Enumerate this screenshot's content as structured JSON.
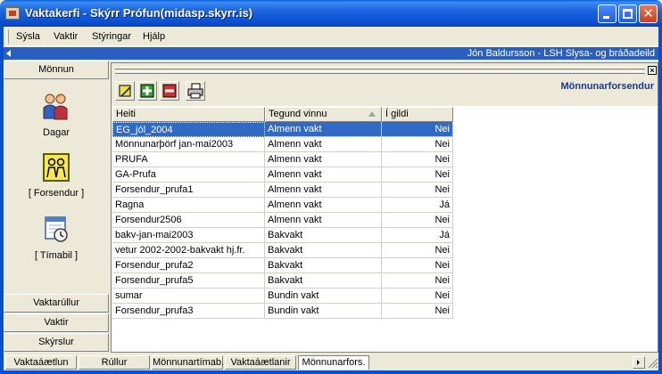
{
  "window": {
    "title": "Vaktakerfi - Skýrr Prófun(midasp.skyrr.is)"
  },
  "menu": {
    "items": [
      "Sýsla",
      "Vaktir",
      "Stýringar",
      "Hjálp"
    ]
  },
  "infobar": {
    "user": "Jón Baldursson - LSH Slysa- og bráðadeild"
  },
  "sidebar": {
    "header": "Mönnun",
    "icons": [
      {
        "label": "Dagar",
        "icon": "people-icon"
      },
      {
        "label": "[ Forsendur ]",
        "icon": "persons-frame-icon"
      },
      {
        "label": "[ Tímabil ]",
        "icon": "calendar-clock-icon"
      }
    ],
    "bottom": [
      "Vaktarúllur",
      "Vaktir",
      "Skýrslur"
    ]
  },
  "main": {
    "title": "Mönnunarforsendur",
    "toolbar": [
      "edit-icon",
      "add-icon",
      "remove-icon",
      "print-icon"
    ],
    "columns": [
      "Heiti",
      "Tegund vinnu",
      "Í gildi"
    ],
    "rows": [
      [
        "EG_jól_2004",
        "Almenn vakt",
        "Nei"
      ],
      [
        "Mönnunarþörf jan-mai2003",
        "Almenn vakt",
        "Nei"
      ],
      [
        "PRUFA",
        "Almenn vakt",
        "Nei"
      ],
      [
        "GA-Prufa",
        "Almenn vakt",
        "Nei"
      ],
      [
        "Forsendur_prufa1",
        "Almenn vakt",
        "Nei"
      ],
      [
        "Ragna",
        "Almenn vakt",
        "Já"
      ],
      [
        "Forsendur2506",
        "Almenn vakt",
        "Nei"
      ],
      [
        "bakv-jan-mai2003",
        "Bakvakt",
        "Já"
      ],
      [
        "vetur 2002-2002-bakvakt hj.fr.",
        "Bakvakt",
        "Nei"
      ],
      [
        "Forsendur_prufa2",
        "Bakvakt",
        "Nei"
      ],
      [
        "Forsendur_prufa5",
        "Bakvakt",
        "Nei"
      ],
      [
        "sumar",
        "Bundin vakt",
        "Nei"
      ],
      [
        "Forsendur_prufa3",
        "Bundin vakt",
        "Nei"
      ]
    ],
    "selected_row": 0
  },
  "status_tabs": [
    "Vaktaáætlun",
    "Rúllur",
    "Mönnunartímab.",
    "Vaktaáætlanir",
    "Mönnunarfors."
  ],
  "active_status_tab": 4,
  "colors": {
    "titlebar": "#0a4fd0",
    "selection": "#316ac5",
    "infobar": "#2a5fbf"
  }
}
